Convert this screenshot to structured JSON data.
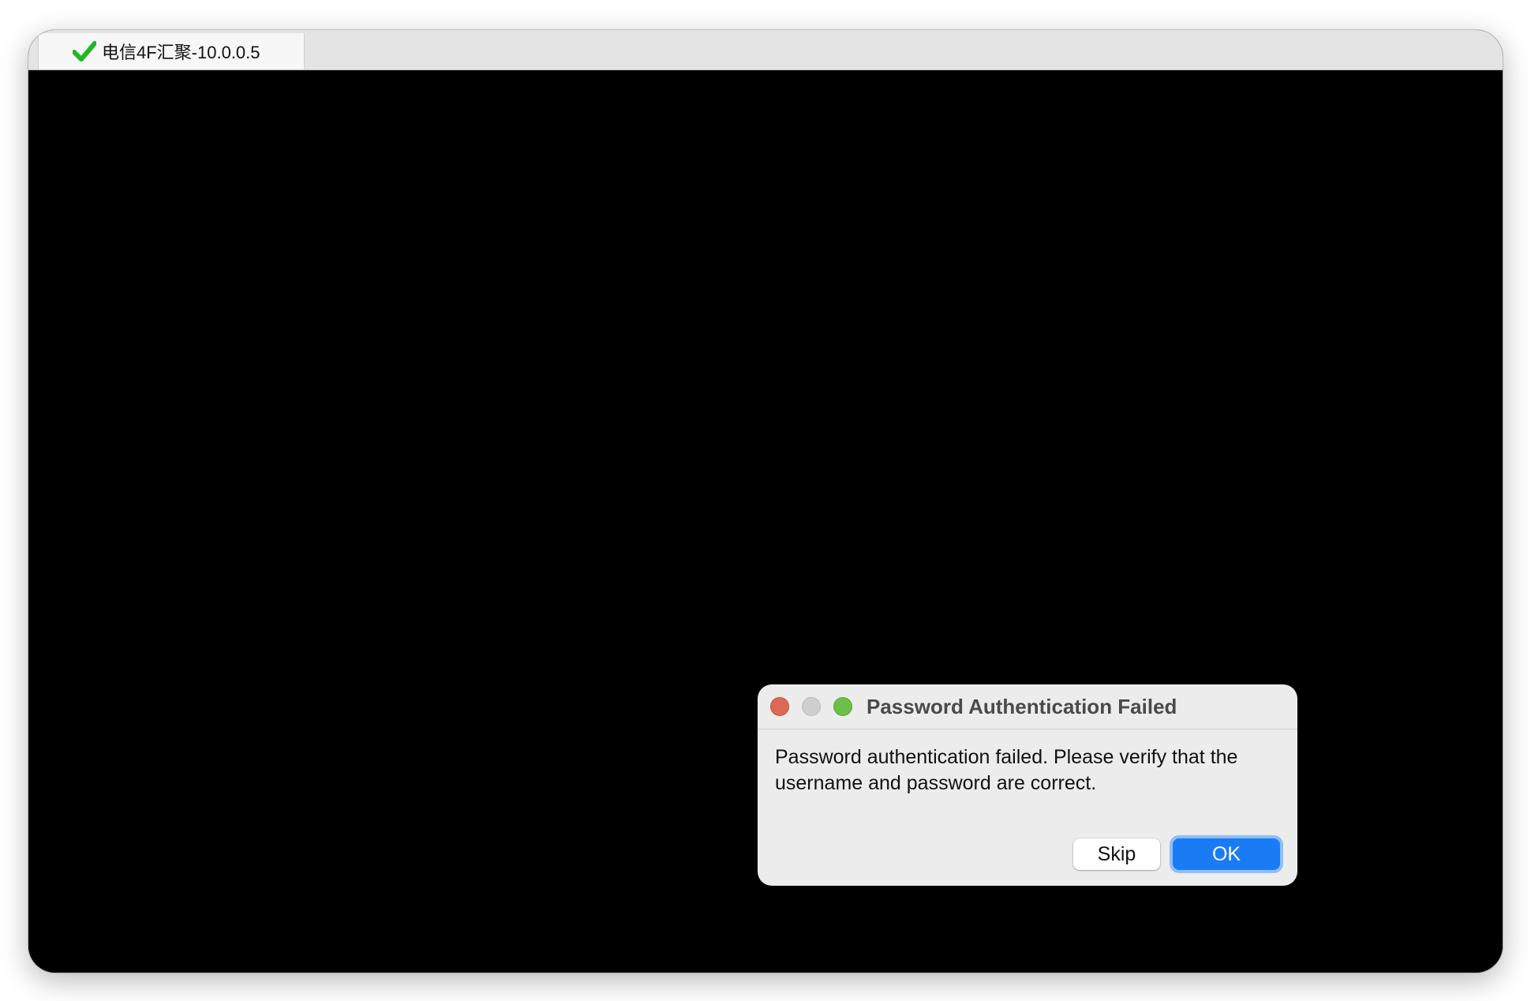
{
  "tab": {
    "title": "电信4F汇聚-10.0.0.5",
    "status_icon": "checkmark-icon",
    "status_color": "#1fb824"
  },
  "colors": {
    "terminal_background": "#000000",
    "primary_button": "#1a7cf5"
  },
  "dialog": {
    "title": "Password Authentication Failed",
    "message": "Password authentication failed. Please verify that the username and password are correct.",
    "buttons": {
      "skip_label": "Skip",
      "ok_label": "OK"
    }
  }
}
